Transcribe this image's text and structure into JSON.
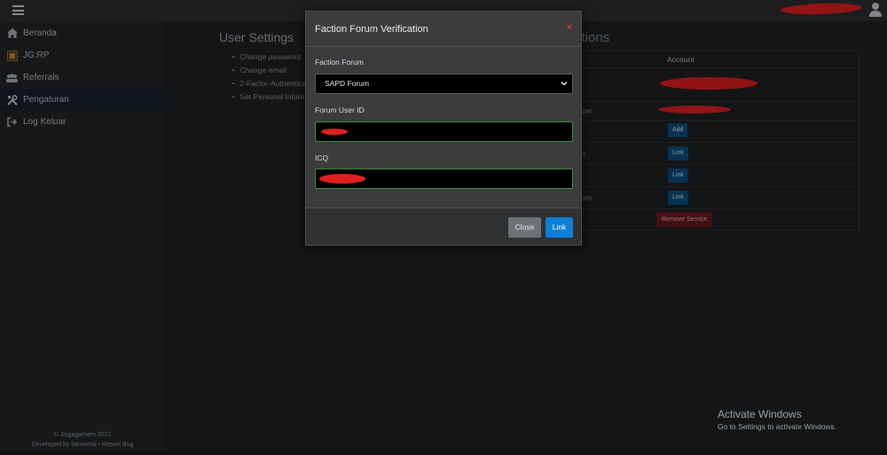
{
  "sidebar": {
    "items": [
      {
        "label": "Beranda",
        "icon": "home-icon"
      },
      {
        "label": "JG:RP",
        "icon": "game-icon"
      },
      {
        "label": "Referrals",
        "icon": "users-icon"
      },
      {
        "label": "Pengaturan",
        "icon": "tools-icon"
      },
      {
        "label": "Log Keluar",
        "icon": "logout-icon"
      }
    ],
    "active_index": 3,
    "footer_line1": "© Jogjagamers 2021",
    "footer_line2": "Developed by tianmetal • Report Bug"
  },
  "settings": {
    "title": "User Settings",
    "links": [
      "Change password",
      "Change email",
      "2-Factor-Authentication",
      "Set Personal Information"
    ]
  },
  "associations": {
    "title": "Associations",
    "account_header": "Account",
    "rows": [
      {
        "label": "",
        "action": ""
      },
      {
        "label": "per",
        "action": ""
      },
      {
        "label": "",
        "action": "Add"
      },
      {
        "label": "o",
        "action": "Link"
      },
      {
        "label": "",
        "action": "Link"
      },
      {
        "label": "um",
        "action": "Link"
      },
      {
        "label": "",
        "action": "Remove Service"
      }
    ]
  },
  "modal": {
    "title": "Faction Forum Verification",
    "close_symbol": "×",
    "faction_forum_label": "Faction Forum",
    "faction_forum_value": "SAPD Forum",
    "forum_user_id_label": "Forum User ID",
    "icq_label": "ICQ",
    "close_button": "Close",
    "link_button": "Link"
  },
  "watermark": {
    "line1": "Activate Windows",
    "line2": "Go to Settings to activate Windows."
  },
  "colors": {
    "accent_blue": "#0d7fd6",
    "danger_red": "#6b1a20",
    "valid_green": "#3c8f3c"
  }
}
